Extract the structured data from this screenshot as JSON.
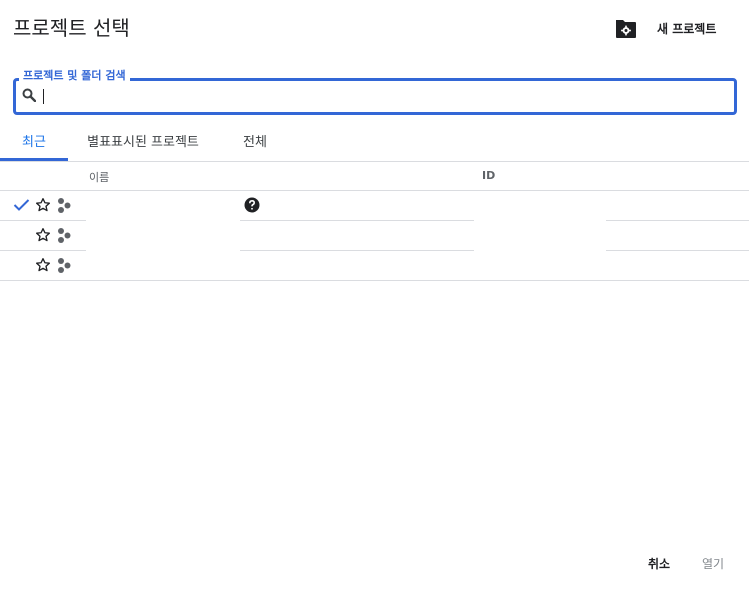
{
  "header": {
    "title": "프로젝트 선택",
    "new_project_label": "새 프로젝트"
  },
  "search": {
    "label": "프로젝트 및 폴더 검색",
    "value": ""
  },
  "tabs": [
    {
      "label": "최근",
      "active": true
    },
    {
      "label": "별표표시된 프로젝트",
      "active": false
    },
    {
      "label": "전체",
      "active": false
    }
  ],
  "table": {
    "columns": {
      "name": "이름",
      "id": "ID"
    }
  },
  "footer": {
    "cancel_label": "취소",
    "open_label": "열기"
  },
  "colors": {
    "accent": "#3367d6",
    "text": "#202124",
    "muted": "#80868b",
    "divider": "#dadce0"
  }
}
